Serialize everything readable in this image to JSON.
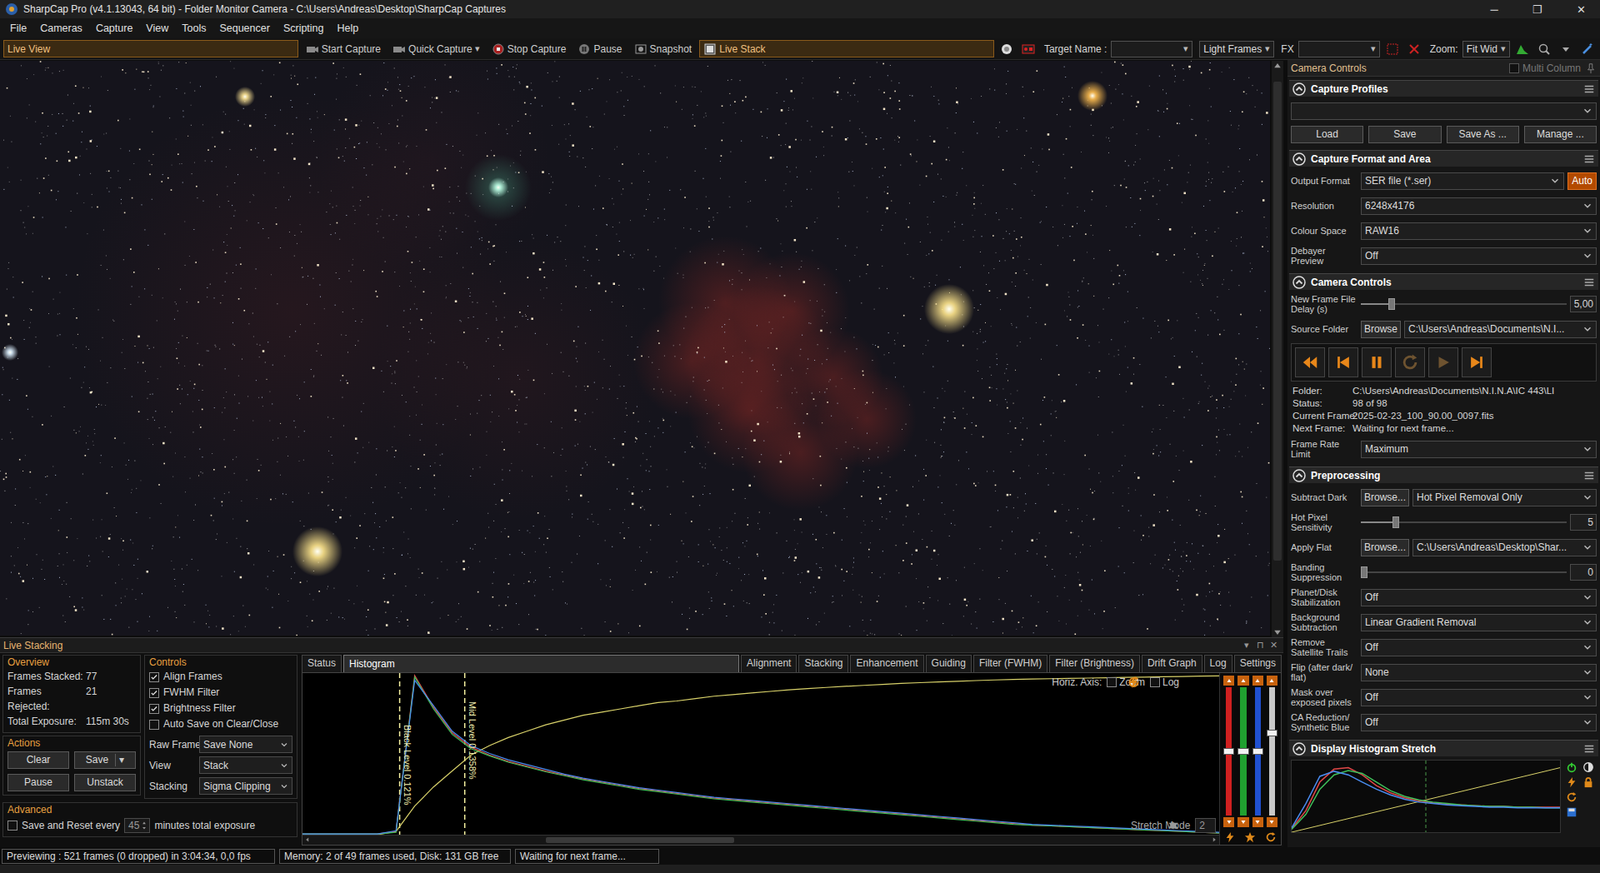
{
  "window": {
    "title": "SharpCap Pro (v4.1.13043, 64 bit) - Folder Monitor Camera - C:\\Users\\Andreas\\Desktop\\SharpCap Captures",
    "controls": [
      "─",
      "❐",
      "✕"
    ]
  },
  "menu": [
    "File",
    "Cameras",
    "Capture",
    "View",
    "Tools",
    "Sequencer",
    "Scripting",
    "Help"
  ],
  "toolbar": [
    {
      "kind": "toggle",
      "label": "Live View",
      "selected": true
    },
    {
      "kind": "button",
      "label": "Start Capture",
      "selected": false
    },
    {
      "kind": "menu-button",
      "label": "Quick Capture",
      "caret": "▾",
      "selected": false
    },
    {
      "kind": "button",
      "label": "Stop Capture",
      "selected": false
    },
    {
      "kind": "button",
      "label": "Pause",
      "selected": false
    },
    {
      "kind": "button",
      "label": "Snapshot",
      "selected": false
    },
    {
      "kind": "toggle",
      "label": "Live Stack",
      "selected": true
    },
    {
      "kind": "icon-button"
    },
    {
      "kind": "icon-button"
    },
    {
      "kind": "combo",
      "label": "Target Name :",
      "value": "",
      "caret": "▾"
    },
    {
      "kind": "select",
      "value": "Light Frames",
      "caret": "▾"
    },
    {
      "kind": "combo",
      "label": "FX",
      "value": "",
      "caret": "▾"
    },
    {
      "kind": "icon-button"
    },
    {
      "kind": "icon-button"
    },
    {
      "kind": "select",
      "label": "Zoom:",
      "value": "Fit Wid",
      "caret": "▾"
    },
    {
      "kind": "icon-button"
    },
    {
      "kind": "icon-button"
    },
    {
      "kind": "icon-button"
    },
    {
      "kind": "icon-button"
    }
  ],
  "viewer": {
    "scrollbar": {
      "start": 0.02,
      "size": 0.86
    }
  },
  "right_panel": {
    "title": "Camera Controls",
    "multi_column": {
      "label": "Multi Column",
      "checked": false
    },
    "sections": [
      {
        "title": "Capture Profiles",
        "expanded": true,
        "rows": [
          {
            "kind": "select",
            "value": ""
          },
          {
            "kind": "buttons",
            "buttons": [
              {
                "label": "Load"
              },
              {
                "label": "Save"
              },
              {
                "label": "Save As ..."
              },
              {
                "label": "Manage ..."
              }
            ]
          }
        ]
      },
      {
        "title": "Capture Format and Area",
        "expanded": true,
        "rows": [
          {
            "kind": "select",
            "label": "Output Format",
            "value": "SER file (*.ser)",
            "extra": "Auto"
          },
          {
            "kind": "select",
            "label": "Resolution",
            "value": "6248x4176"
          },
          {
            "kind": "select",
            "label": "Colour Space",
            "value": "RAW16"
          },
          {
            "kind": "select",
            "label": "Debayer Preview",
            "value": "Off"
          }
        ]
      },
      {
        "title": "Camera Controls",
        "expanded": true,
        "rows": [
          {
            "kind": "slider",
            "label": "New Frame File Delay (s)",
            "level": 0.14,
            "value": "5,00"
          },
          {
            "kind": "browse",
            "label": "Source Folder",
            "button": "Browse",
            "value": "C:\\Users\\Andreas\\Documents\\N.I..."
          },
          {
            "kind": "player",
            "buttons": [
              {
                "disabled": false
              },
              {
                "disabled": false
              },
              {
                "disabled": false
              },
              {
                "disabled": true
              },
              {
                "disabled": true
              },
              {
                "disabled": false
              }
            ]
          },
          {
            "kind": "info",
            "items": [
              {
                "label": "Folder:",
                "value": "C:\\Users\\Andreas\\Documents\\N.I.N.A\\IC 443\\LI"
              },
              {
                "label": "Status:",
                "value": "98 of 98"
              },
              {
                "label": "Current Frame:",
                "value": "2025-02-23_100_90.00_0097.fits"
              },
              {
                "label": "Next Frame:",
                "value": "Waiting for next frame..."
              }
            ]
          },
          {
            "kind": "select",
            "label": "Frame Rate Limit",
            "value": "Maximum"
          }
        ]
      },
      {
        "title": "Preprocessing",
        "expanded": true,
        "rows": [
          {
            "kind": "browse",
            "label": "Subtract Dark",
            "button": "Browse...",
            "value": "Hot Pixel Removal Only"
          },
          {
            "kind": "slider",
            "label": "Hot Pixel Sensitivity",
            "level": 0.16,
            "value": "5"
          },
          {
            "kind": "browse",
            "label": "Apply Flat",
            "button": "Browse...",
            "value": "C:\\Users\\Andreas\\Desktop\\Shar..."
          },
          {
            "kind": "slider",
            "label": "Banding Suppression",
            "level": 0,
            "value": "0"
          },
          {
            "kind": "select",
            "label": "Planet/Disk Stabilization",
            "value": "Off"
          },
          {
            "kind": "select",
            "label": "Background Subtraction",
            "value": "Linear Gradient Removal"
          },
          {
            "kind": "select",
            "label": "Remove Satellite Trails",
            "value": "Off"
          },
          {
            "kind": "select",
            "label": "Flip (after dark/ flat)",
            "value": "None"
          },
          {
            "kind": "select",
            "label": "Mask over exposed pixels",
            "value": "Off"
          },
          {
            "kind": "select",
            "label": "CA Reduction/ Synthetic Blue",
            "value": "Off"
          }
        ]
      },
      {
        "title": "Display Histogram Stretch",
        "expanded": true,
        "rows": [
          {
            "kind": "minihist",
            "line_color": "#d9d26a",
            "marker": 0.5,
            "series": [
              {
                "color": "#e04848",
                "values": [
                  5,
                  30,
                  70,
                  88,
                  90,
                  80,
                  65,
                  55,
                  48,
                  44,
                  41,
                  39,
                  38,
                  37,
                  36,
                  36,
                  35,
                  35,
                  35,
                  35
                ]
              },
              {
                "color": "#3fbf5a",
                "values": [
                  4,
                  25,
                  60,
                  80,
                  86,
                  82,
                  70,
                  58,
                  50,
                  45,
                  42,
                  40,
                  38,
                  37,
                  36,
                  36,
                  35,
                  35,
                  34,
                  34
                ]
              },
              {
                "color": "#4a8cf0",
                "values": [
                  6,
                  40,
                  78,
                  85,
                  80,
                  70,
                  60,
                  52,
                  46,
                  42,
                  40,
                  38,
                  37,
                  36,
                  35,
                  35,
                  34,
                  34,
                  34,
                  34
                ]
              }
            ]
          }
        ]
      }
    ]
  },
  "live_stacking": {
    "title": "Live Stacking",
    "window_controls": [
      "▾",
      "⊓",
      "✕"
    ],
    "overview": {
      "title": "Overview",
      "rows": [
        {
          "label": "Frames Stacked:",
          "value": "77"
        },
        {
          "label": "Frames Rejected:",
          "value": "21"
        },
        {
          "label": "Total Exposure:",
          "value": "115m 30s"
        }
      ]
    },
    "actions": {
      "title": "Actions",
      "buttons": [
        {
          "label": "Clear"
        },
        {
          "label": "Save",
          "caret": "▾"
        },
        {
          "label": "Pause"
        },
        {
          "label": "Unstack"
        }
      ]
    },
    "advanced": {
      "title": "Advanced",
      "save_reset": {
        "checked": false,
        "label": "Save and Reset every",
        "value": "45",
        "suffix": "minutes total exposure"
      }
    },
    "controls": {
      "title": "Controls",
      "checks": [
        {
          "label": "Align Frames",
          "checked": true
        },
        {
          "label": "FWHM Filter",
          "checked": true
        },
        {
          "label": "Brightness Filter",
          "checked": true
        },
        {
          "label": "Auto Save on Clear/Close",
          "checked": false
        }
      ],
      "selects": [
        {
          "label": "Raw Frames",
          "value": "Save None"
        },
        {
          "label": "View",
          "value": "Stack"
        },
        {
          "label": "Stacking",
          "value": "Sigma Clipping"
        }
      ]
    },
    "tabs": [
      {
        "label": "Status",
        "selected": false
      },
      {
        "label": "Histogram",
        "selected": true
      },
      {
        "label": "Alignment",
        "selected": false
      },
      {
        "label": "Stacking",
        "selected": false
      },
      {
        "label": "Enhancement",
        "selected": false
      },
      {
        "label": "Guiding",
        "selected": false
      },
      {
        "label": "Filter (FWHM)",
        "selected": false
      },
      {
        "label": "Filter (Brightness)",
        "selected": false
      },
      {
        "label": "Drift Graph",
        "selected": false
      },
      {
        "label": "Log",
        "selected": false
      },
      {
        "label": "Settings",
        "selected": false
      }
    ],
    "histogram": {
      "markers": [
        {
          "label": "Black Level 0.121%",
          "position": 10.6
        },
        {
          "label": "Mid Level 0.1358%",
          "position": 17.7
        }
      ],
      "series": [
        {
          "color": "#e04848",
          "values": [
            0.5,
            0.5,
            0.5,
            0.5,
            0.5,
            2,
            100,
            80,
            64,
            55,
            50,
            46,
            43,
            40,
            37.5,
            35,
            33,
            31,
            29,
            27.5,
            26,
            24.5,
            23,
            22,
            21,
            20,
            19,
            18,
            17,
            16,
            15,
            14,
            13,
            12,
            11,
            10,
            9,
            8,
            7,
            6,
            5.5,
            5,
            4.5,
            4,
            3.5,
            3,
            2.5,
            2,
            1.5,
            1
          ]
        },
        {
          "color": "#3fbf5a",
          "values": [
            0.5,
            0.5,
            0.5,
            0.5,
            0.5,
            1.5,
            99,
            79,
            63,
            54,
            49.5,
            45.5,
            42.5,
            39.5,
            37,
            34.5,
            32.5,
            30.5,
            28.5,
            27,
            25.5,
            24,
            22.5,
            21.5,
            20.5,
            19.5,
            18.5,
            17.5,
            16.5,
            15.5,
            14.5,
            13.5,
            12.5,
            11.5,
            10.5,
            9.5,
            8.5,
            7.5,
            6.5,
            6,
            5.5,
            5,
            4.5,
            4,
            3.5,
            3,
            2.5,
            2,
            1.5,
            1
          ]
        },
        {
          "color": "#4a8cf0",
          "values": [
            0.5,
            0.5,
            0.5,
            0.5,
            0.5,
            2.5,
            97,
            81,
            65,
            56,
            51,
            47,
            44,
            41,
            38,
            35.5,
            33.5,
            31.5,
            29.5,
            28,
            26.5,
            25,
            23.5,
            22.5,
            21.5,
            20.5,
            19.5,
            18.5,
            17.5,
            16.5,
            15.5,
            14.5,
            13.5,
            12.5,
            11.5,
            10.5,
            9.5,
            8.5,
            7.5,
            6.5,
            6,
            5.5,
            5,
            4.5,
            4,
            3.5,
            3,
            2.5,
            2,
            1.5
          ]
        }
      ],
      "stretch_curve": {
        "color": "#d9d26a",
        "values": [
          0,
          0,
          0,
          0,
          0,
          2,
          18,
          30,
          40,
          50,
          56,
          61,
          65,
          69,
          72,
          75,
          77,
          79,
          81,
          83,
          84,
          85.5,
          87,
          88,
          89,
          90,
          91,
          91.8,
          92.5,
          93.2,
          93.8,
          94.4,
          95,
          95.5,
          96,
          96.4,
          96.8,
          97.2,
          97.5,
          97.8,
          98,
          98.2,
          98.4,
          98.6,
          98.8,
          99,
          99.2,
          99.4,
          99.6,
          99.8
        ]
      },
      "axis": {
        "label": "Horiz. Axis:",
        "options": [
          {
            "label": "Zoom",
            "checked": true
          },
          {
            "label": "Log",
            "checked": true
          }
        ]
      },
      "stretch_mode": {
        "label": "Stretch Mode",
        "value": "2"
      },
      "scrollbar": {
        "start": 0.26,
        "size": 0.21
      },
      "channel_sliders": [
        {
          "color": "#d02020",
          "level": 0.5
        },
        {
          "color": "#20a030",
          "level": 0.5
        },
        {
          "color": "#2050d0",
          "level": 0.5
        },
        {
          "color": "#c8c8c8",
          "level": 0.65
        }
      ]
    }
  },
  "status_bar": [
    "Previewing : 521 frames (0 dropped) in 3:04:34, 0,0 fps",
    "Memory: 2 of 49 frames used, Disk: 131 GB free",
    "Waiting for next frame..."
  ]
}
